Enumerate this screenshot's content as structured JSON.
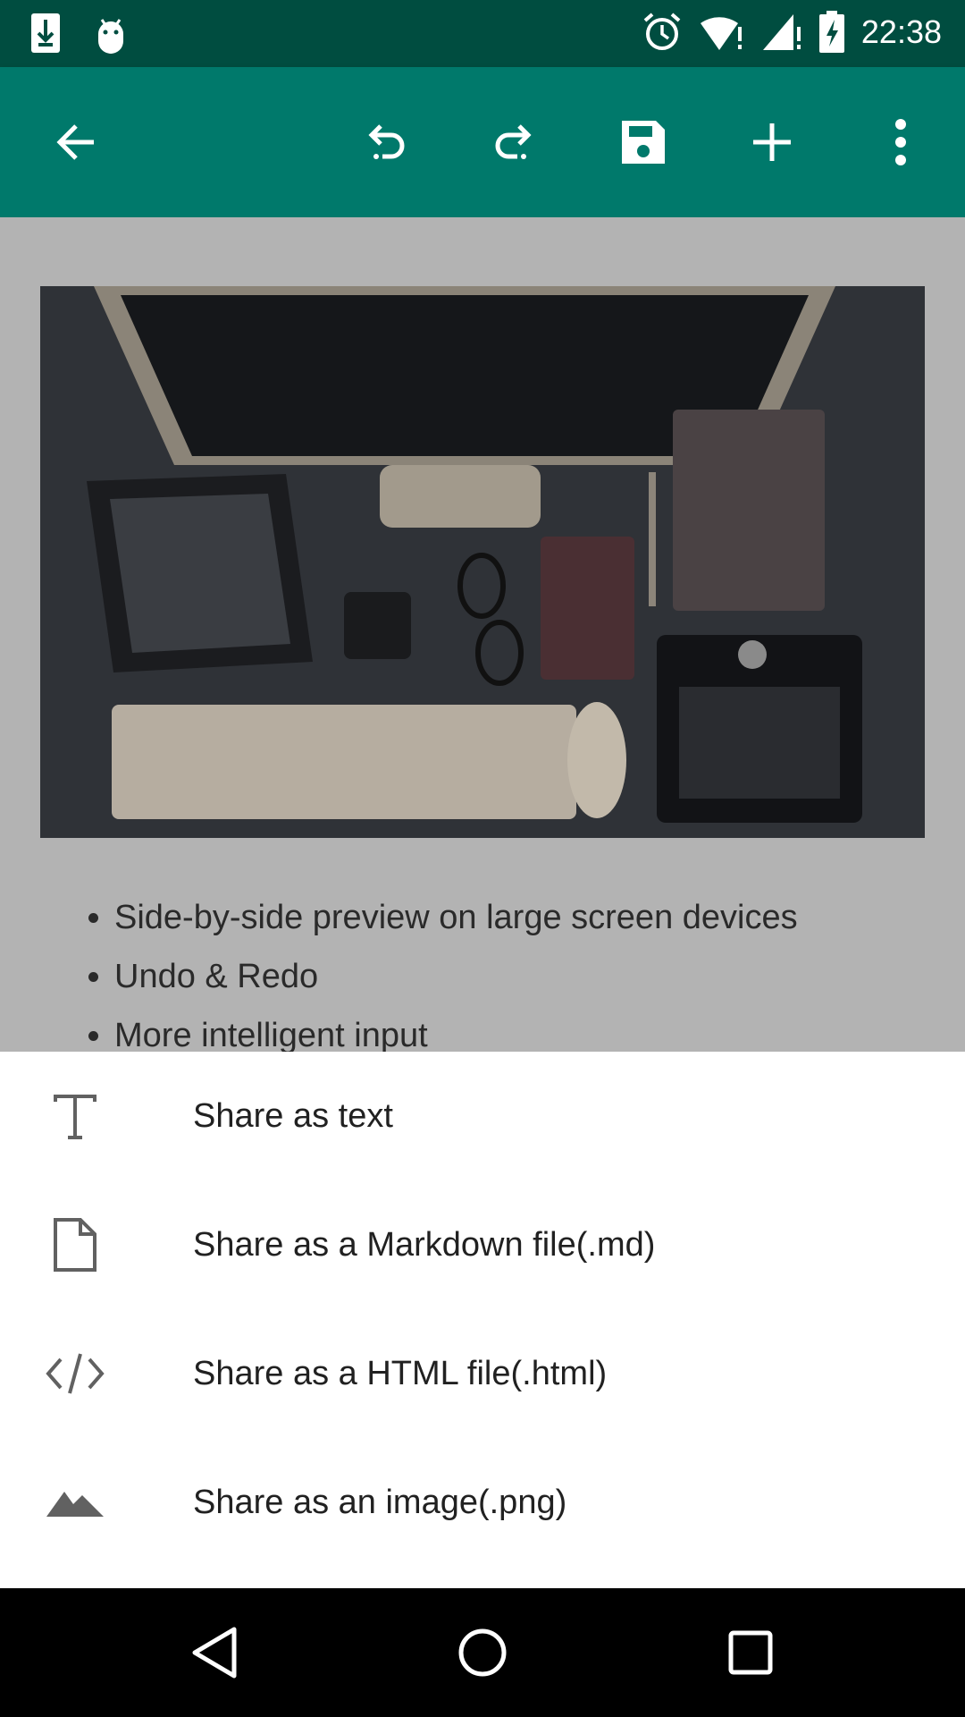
{
  "status_bar": {
    "time": "22:38",
    "left_icons": [
      "download-icon",
      "android-icon"
    ],
    "right_icons": [
      "alarm-icon",
      "wifi-icon",
      "signal-icon",
      "battery-icon"
    ]
  },
  "toolbar": {
    "buttons": [
      "back-arrow-icon",
      "undo-icon",
      "redo-icon",
      "save-icon",
      "add-icon",
      "more-vert-icon"
    ]
  },
  "content": {
    "bullets": [
      "Side-by-side preview on large screen devices",
      "Undo & Redo",
      "More intelligent input"
    ]
  },
  "share_sheet": {
    "items": [
      {
        "label": "Share as text",
        "icon": "text-format-icon"
      },
      {
        "label": "Share as a Markdown file(.md)",
        "icon": "file-icon"
      },
      {
        "label": "Share as a HTML file(.html)",
        "icon": "code-icon"
      },
      {
        "label": "Share as an image(.png)",
        "icon": "image-icon"
      }
    ]
  },
  "colors": {
    "status_bar": "#004d40",
    "toolbar": "#00796b",
    "scrim_content": "#b3b3b3",
    "sheet": "#ffffff"
  }
}
